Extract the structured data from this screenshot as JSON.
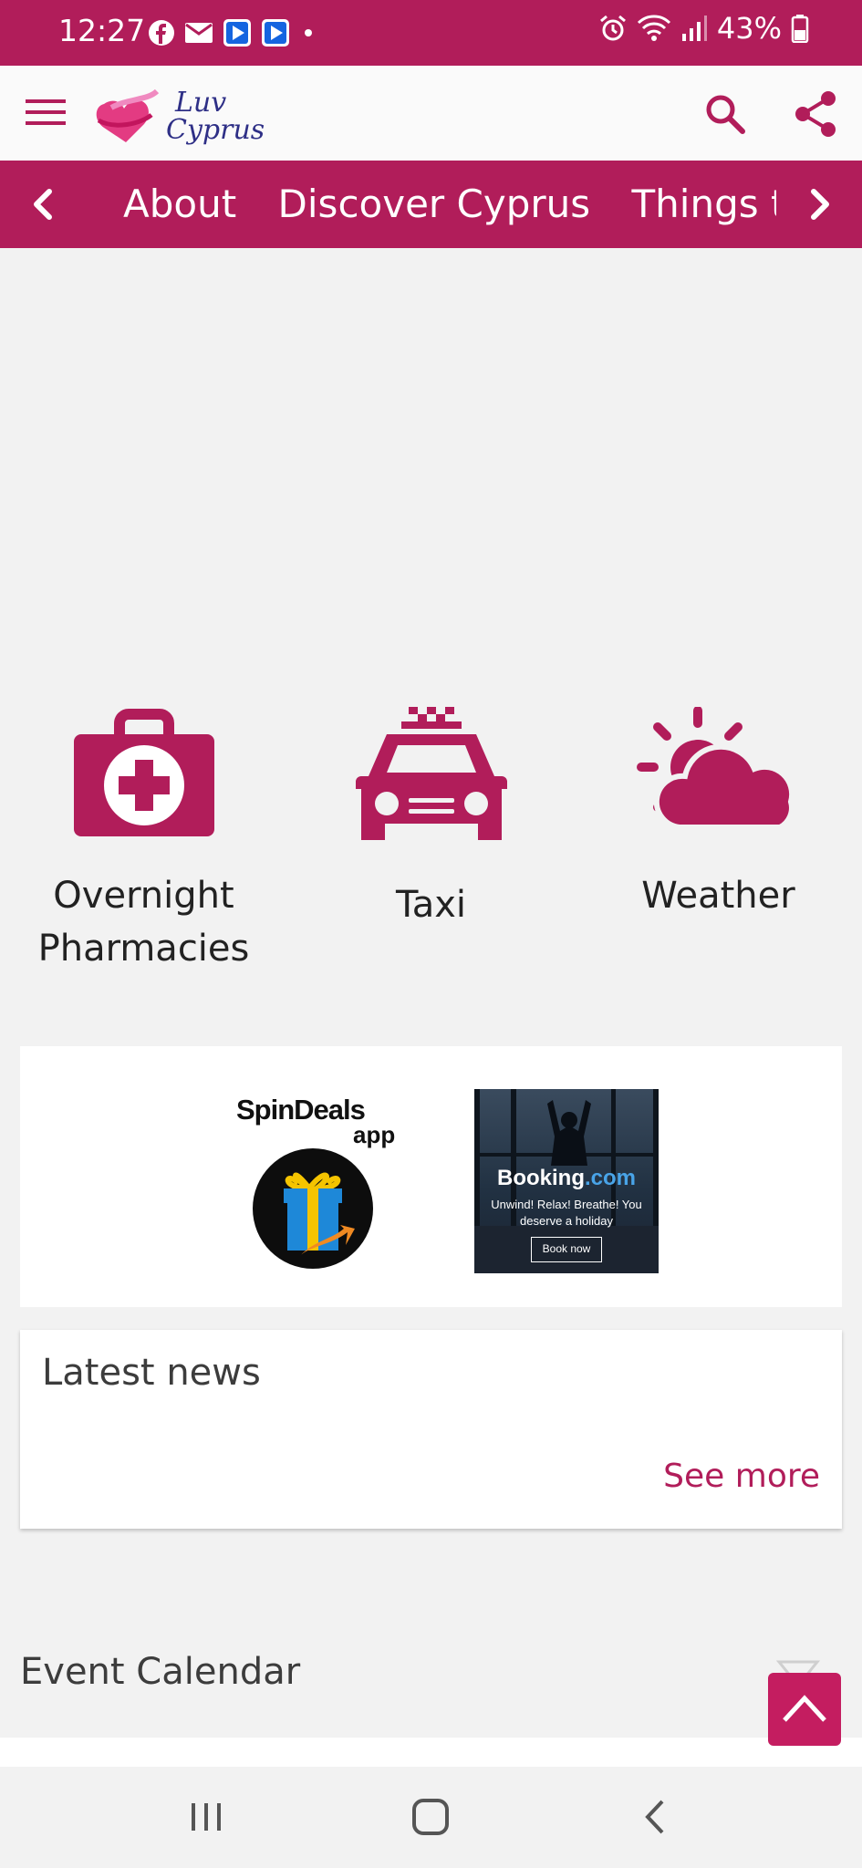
{
  "status_bar": {
    "time": "12:27",
    "battery": "43%",
    "notification_icons": [
      "facebook-icon",
      "mail-icon",
      "play-icon",
      "play-icon",
      "dot-icon"
    ],
    "system_icons": [
      "alarm-icon",
      "wifi-icon",
      "signal-icon",
      "battery-icon"
    ]
  },
  "header": {
    "logo_text": "Luv Cyprus",
    "icons": [
      "menu-icon",
      "search-icon",
      "share-icon"
    ]
  },
  "nav": {
    "items": [
      "About",
      "Discover Cyprus",
      "Things to do"
    ]
  },
  "quick_links": [
    {
      "label": "Overnight\nPharmacies",
      "icon": "medical-kit-icon"
    },
    {
      "label": "Taxi",
      "icon": "taxi-icon"
    },
    {
      "label": "Weather",
      "icon": "weather-icon"
    }
  ],
  "ads": {
    "spindeals": {
      "title": "SpinDeals",
      "subtitle": "app"
    },
    "booking": {
      "brand": "Booking",
      "brand_suffix": ".com",
      "tagline": "Unwind! Relax! Breathe! You deserve a holiday",
      "cta": "Book now"
    }
  },
  "news": {
    "title": "Latest news",
    "see_more": "See more"
  },
  "events": {
    "title": "Event Calendar"
  },
  "colors": {
    "accent": "#b11d5a",
    "scroll_button": "#c41d60",
    "background": "#f2f2f2"
  }
}
